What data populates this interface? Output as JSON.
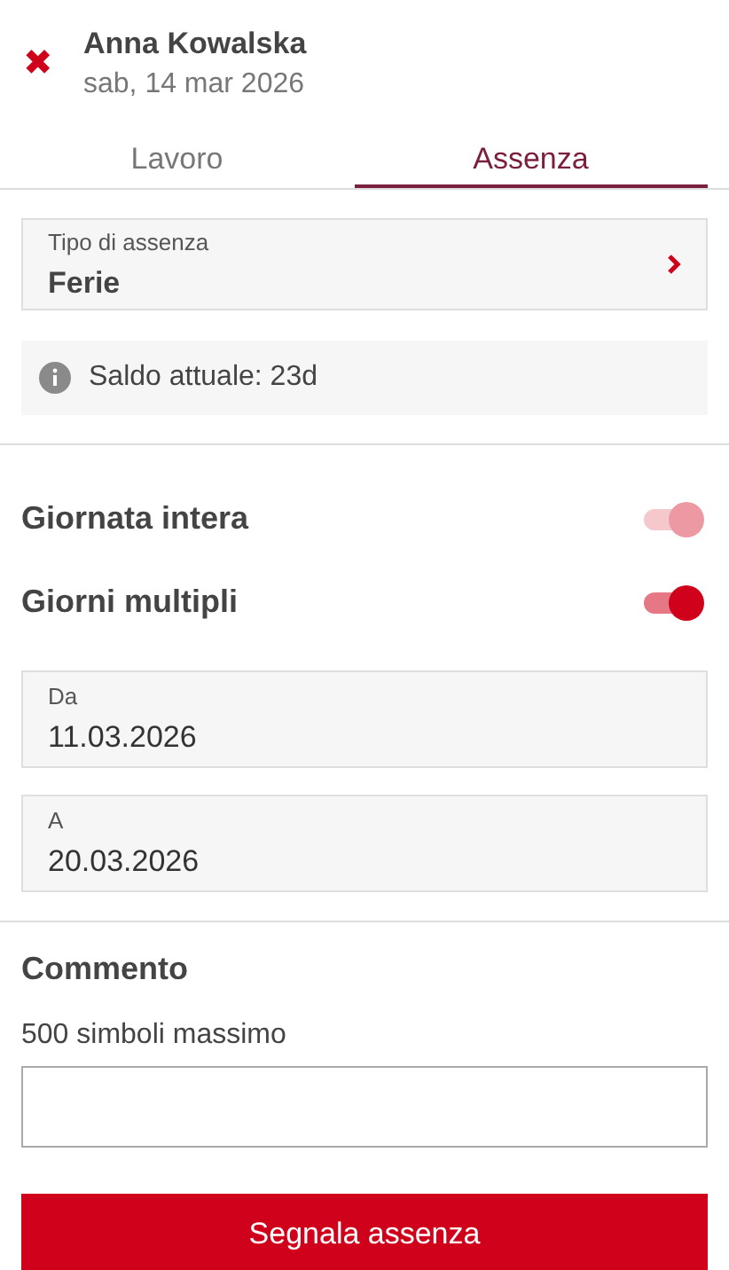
{
  "header": {
    "close_icon": "✖",
    "name": "Anna Kowalska",
    "date": "sab, 14 mar 2026"
  },
  "tabs": [
    {
      "label": "Lavoro",
      "selected": false
    },
    {
      "label": "Assenza",
      "selected": true
    }
  ],
  "absence_type": {
    "label": "Tipo di assenza",
    "value": "Ferie"
  },
  "balance": {
    "text": "Saldo attuale: 23d"
  },
  "toggles": [
    {
      "label": "Giornata intera",
      "on": true,
      "disabled": true
    },
    {
      "label": "Giorni multipli",
      "on": true,
      "disabled": false
    }
  ],
  "dates": [
    {
      "label": "Da",
      "value": "11.03.2026"
    },
    {
      "label": "A",
      "value": "20.03.2026"
    }
  ],
  "comment": {
    "title": "Commento",
    "hint": "500 simboli massimo"
  },
  "submit_button": "Segnala assenza"
}
